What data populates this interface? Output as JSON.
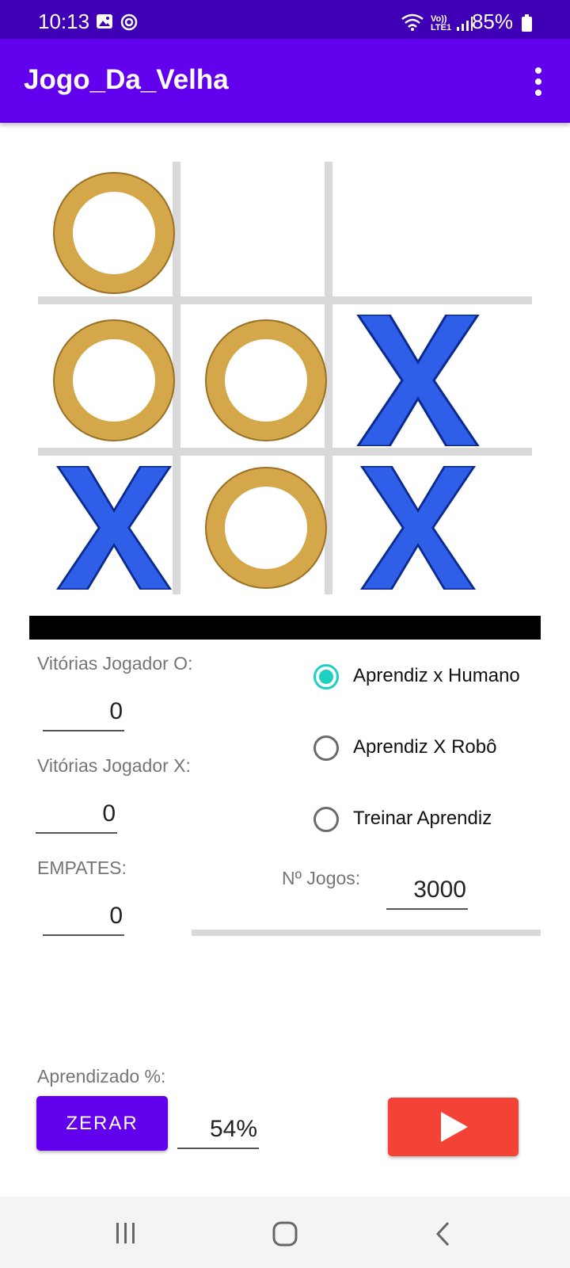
{
  "status_bar": {
    "time": "10:13",
    "battery": "85%",
    "network": "Vo)) LTE1",
    "icons": [
      "image-icon",
      "circle-target-icon",
      "wifi-icon",
      "signal-icon",
      "battery-icon"
    ]
  },
  "app_bar": {
    "title": "Jogo_Da_Velha",
    "menu_icon": "more-vertical-icon",
    "color": "#6200ee"
  },
  "board": {
    "cells": [
      "O",
      "",
      "",
      "O",
      "O",
      "X",
      "X",
      "O",
      "X"
    ],
    "o_color": "#d4a84a",
    "x_color": "#2f5fe8"
  },
  "stats": {
    "o_wins_label": "Vitórias Jogador O:",
    "o_wins_value": "0",
    "x_wins_label": "Vitórias Jogador X:",
    "x_wins_value": "0",
    "draws_label": "EMPATES:",
    "draws_value": "0"
  },
  "modes": {
    "selected": 0,
    "options": [
      "Aprendiz x Humano",
      "Aprendiz X Robô",
      "Treinar Aprendiz"
    ],
    "accent": "#1cd1c2"
  },
  "games": {
    "label": "Nº Jogos:",
    "value": "3000",
    "progress": 0
  },
  "learning": {
    "label": "Aprendizado %:",
    "value": "54%"
  },
  "buttons": {
    "reset_label": "ZERAR",
    "play_icon": "play-icon",
    "play_color": "#f44336"
  },
  "nav_bar": {
    "icons": [
      "recent-apps-icon",
      "home-icon",
      "back-icon"
    ]
  }
}
